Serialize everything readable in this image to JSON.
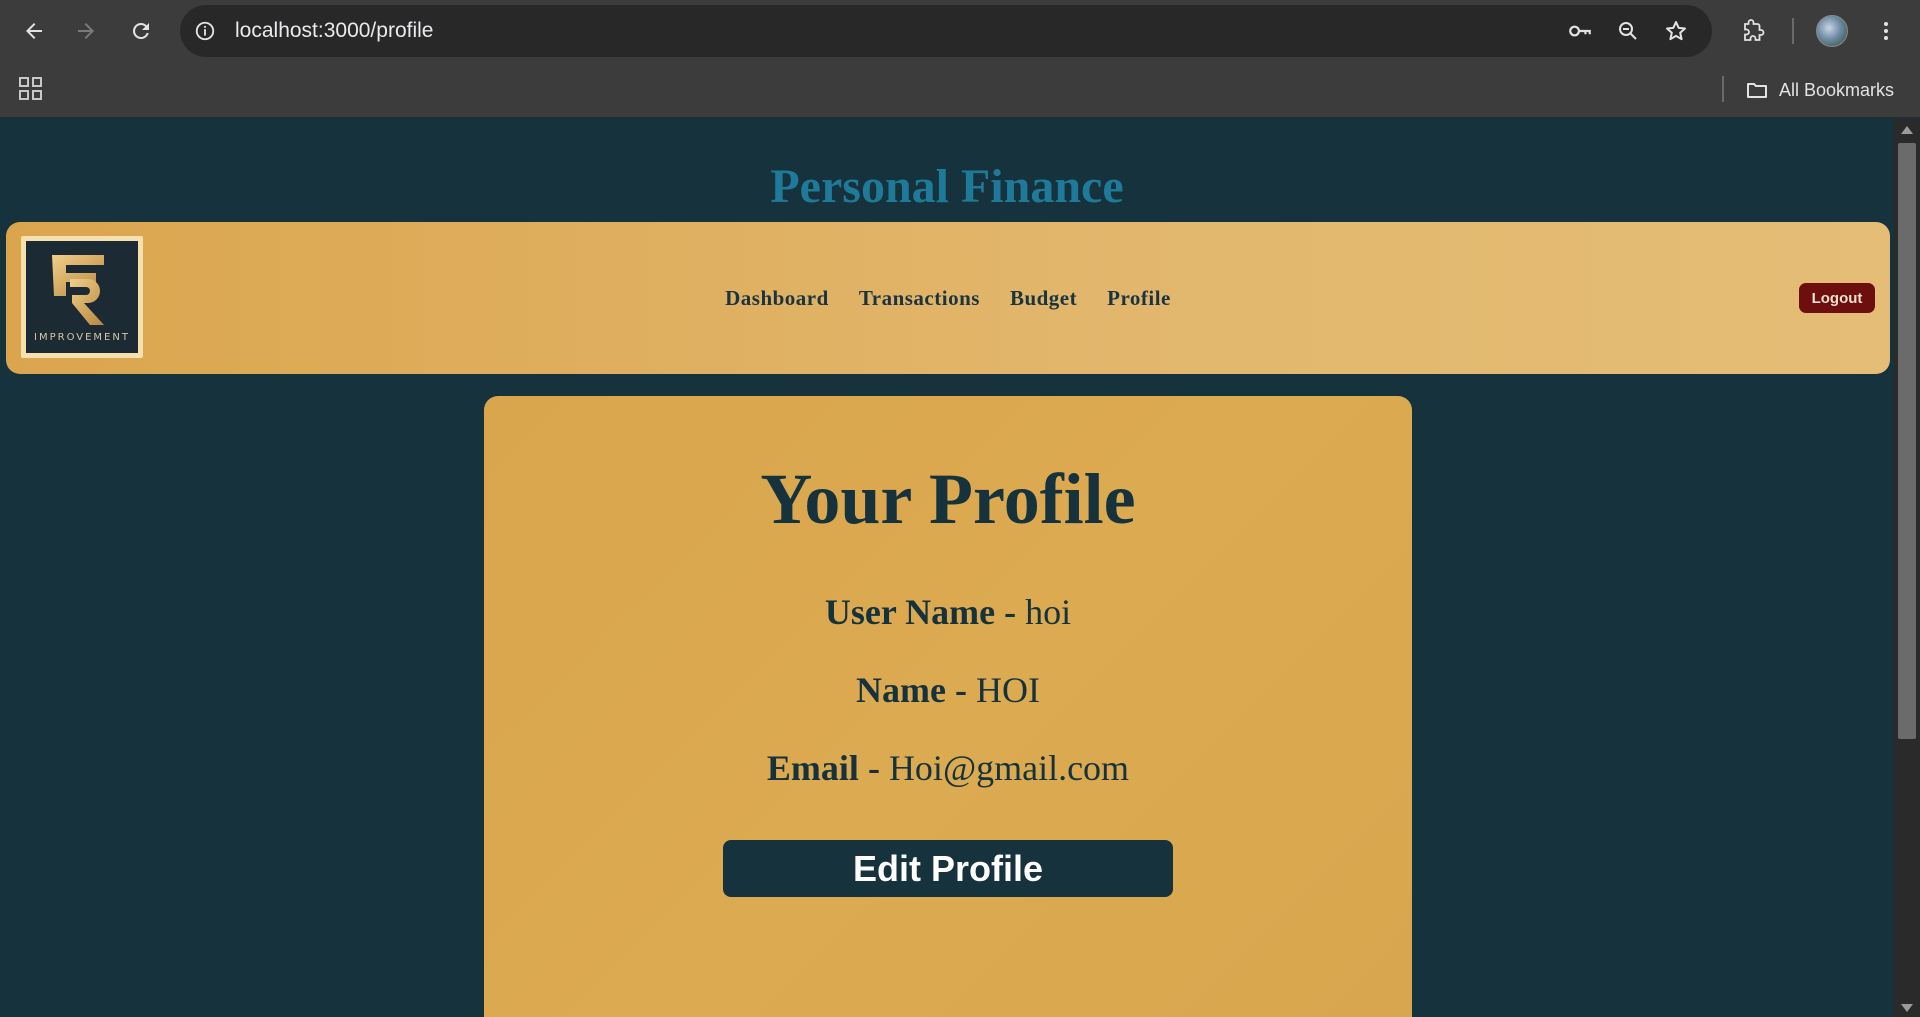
{
  "browser": {
    "url": "localhost:3000/profile",
    "bookmarks_label": "All Bookmarks"
  },
  "site": {
    "title": "Personal Finance",
    "logo_text": "IMPROVEMENT"
  },
  "nav": {
    "items": [
      {
        "label": "Dashboard"
      },
      {
        "label": "Transactions"
      },
      {
        "label": "Budget"
      },
      {
        "label": "Profile"
      }
    ],
    "logout_label": "Logout"
  },
  "profile": {
    "heading": "Your Profile",
    "username_label": "User Name",
    "username_value": "hoi",
    "name_label": "Name",
    "name_value": "HOI",
    "email_label": "Email",
    "email_value": "Hoi@gmail.com",
    "separator": "-",
    "edit_label": "Edit Profile"
  },
  "colors": {
    "page_bg": "#15323d",
    "accent_gold": "#dba54e",
    "title_blue": "#1f7a9a",
    "logout_red": "#6e0f0f"
  }
}
